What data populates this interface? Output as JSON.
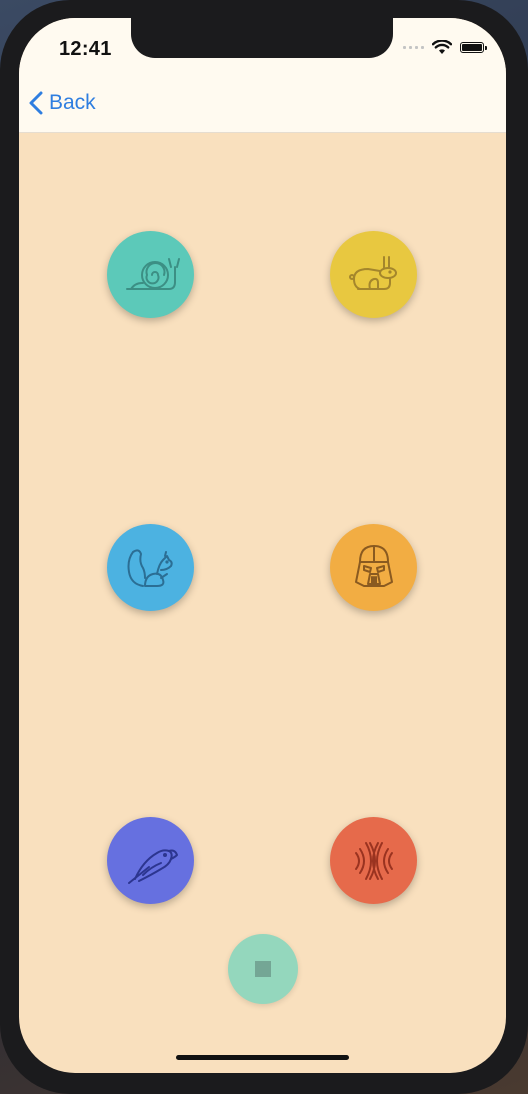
{
  "status_bar": {
    "time": "12:41",
    "icons": [
      "cellular-icon",
      "wifi-icon",
      "battery-icon"
    ]
  },
  "nav": {
    "back_label": "Back"
  },
  "animals": [
    {
      "name": "snail",
      "color": "#5cc9b9",
      "icon": "snail-icon"
    },
    {
      "name": "rabbit",
      "color": "#e8c840",
      "icon": "rabbit-icon"
    },
    {
      "name": "squirrel",
      "color": "#4cb2e1",
      "icon": "squirrel-icon"
    },
    {
      "name": "vader",
      "color": "#f2ad43",
      "icon": "darth-vader-icon"
    },
    {
      "name": "parrot",
      "color": "#6670e0",
      "icon": "parrot-icon"
    },
    {
      "name": "waves",
      "color": "#e66a4b",
      "icon": "sound-waves-icon"
    }
  ],
  "stop_button": {
    "color": "#94d7bd",
    "icon": "stop-icon"
  },
  "colors": {
    "background": "#f9e0be",
    "nav_background": "#fffaf0",
    "accent": "#2f7ee0"
  }
}
